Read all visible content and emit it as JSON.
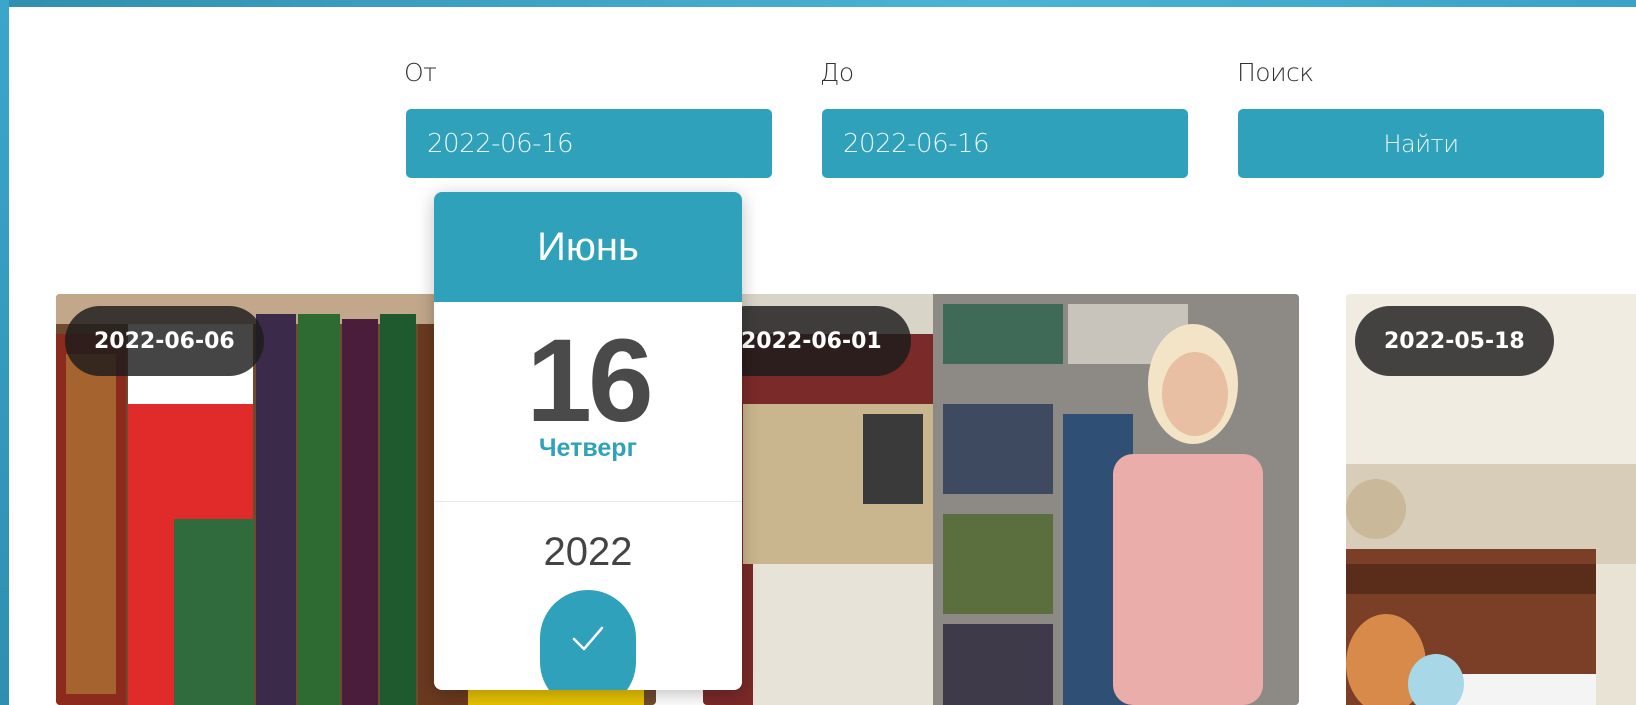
{
  "filters": {
    "from_label": "От",
    "from_value": "2022-06-16",
    "to_label": "До",
    "to_value": "2022-06-16",
    "search_label": "Поиск",
    "search_button": "Найти"
  },
  "cards": [
    {
      "date": "2022-06-06"
    },
    {
      "date": "2022-06-01"
    },
    {
      "date": "2022-05-18"
    }
  ],
  "picker": {
    "month": "Июнь",
    "day": "16",
    "weekday": "Четверг",
    "year": "2022",
    "confirm_icon": "check-icon"
  },
  "colors": {
    "accent": "#2fa1ba",
    "badge": "#1c1c1c",
    "frame": "#3aa6cc"
  }
}
